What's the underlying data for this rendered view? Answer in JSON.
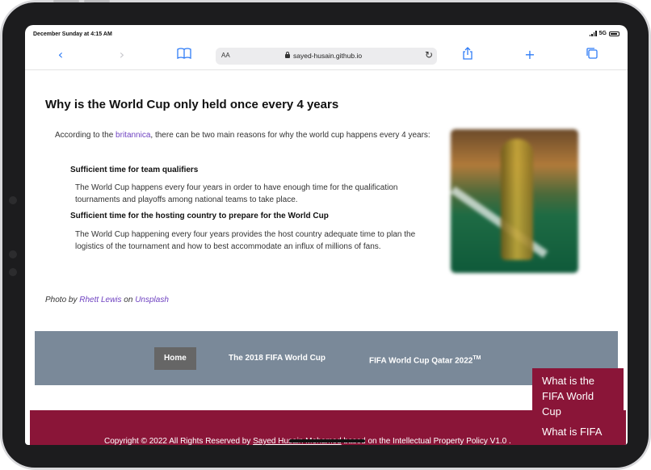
{
  "status_bar": {
    "time": "December Sunday at 4:15 AM",
    "network": "5G"
  },
  "browser": {
    "text_size_label": "AA",
    "url": "sayed-husain.github.io",
    "icons": [
      "back-icon",
      "forward-icon",
      "bookmarks-icon",
      "reload-icon",
      "share-icon",
      "new-tab-icon",
      "tabs-icon"
    ],
    "accent_color": "#2f7cf6"
  },
  "article": {
    "heading": "Why is the World Cup only held once every 4 years",
    "intro_prefix": "According to the ",
    "intro_link": "britannica",
    "intro_suffix": ", there can be two main reasons for why the world cup happens every 4 years:",
    "reasons": [
      {
        "title": "Sufficient time for team qualifiers",
        "text": "The World Cup happens every four years in order to have enough time for the qualification tournaments and playoffs among national teams to take place."
      },
      {
        "title": "Sufficient time for the hosting country to prepare for the World Cup",
        "text": "The World Cup happening every four years provides the host country adequate time to plan the logistics of the tournament and how to best accommodate an influx of millions of fans."
      }
    ],
    "credit_prefix": "Photo by ",
    "credit_author": "Rhett Lewis",
    "credit_middle": " on ",
    "credit_source": "Unsplash"
  },
  "nav": {
    "items": [
      {
        "label": "Home",
        "active": true
      },
      {
        "label": "The 2018 FIFA World Cup"
      },
      {
        "label": "FIFA World Cup Qatar 2022",
        "sup": "TM"
      }
    ],
    "background": "#7a8999"
  },
  "dropdown": {
    "items": [
      "What is the FIFA World Cup",
      "What is FIFA"
    ],
    "background": "#8a1538"
  },
  "footer": {
    "prefix": "Copyright © 2022 All Rights Reserved by ",
    "author": "Sayed Husain Mohamed",
    "suffix": " based on the Intellectual Property Policy V1.0 .",
    "background": "#8a1538"
  }
}
